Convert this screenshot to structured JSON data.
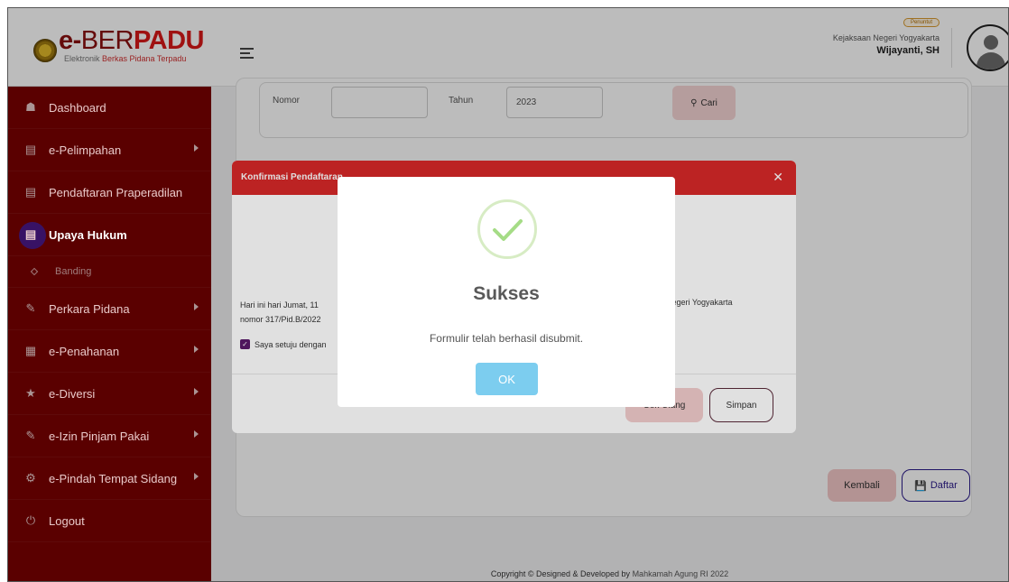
{
  "brand": {
    "name_e": "e-",
    "name_b1": "BER",
    "name_b2": "PADU",
    "sub_a": "Elektronik ",
    "sub_b": "Berkas Pidana Terpadu"
  },
  "sidebar": {
    "items": [
      {
        "label": "Dashboard",
        "icon": "home-icon"
      },
      {
        "label": "e-Pelimpahan",
        "icon": "document-icon",
        "arrow": true
      },
      {
        "label": "Pendaftaran Praperadilan",
        "icon": "document-icon"
      },
      {
        "label": "Upaya Hukum",
        "icon": "document-icon",
        "active": true
      },
      {
        "label": "Banding",
        "icon": "diamond-icon",
        "sub": true
      },
      {
        "label": "Perkara Pidana",
        "icon": "edit-icon",
        "arrow": true
      },
      {
        "label": "e-Penahanan",
        "icon": "grid-icon",
        "arrow": true
      },
      {
        "label": "e-Diversi",
        "icon": "star-icon",
        "arrow": true
      },
      {
        "label": "e-Izin Pinjam Pakai",
        "icon": "edit-icon",
        "arrow": true
      },
      {
        "label": "e-Pindah Tempat Sidang",
        "icon": "gear-icon",
        "arrow": true
      },
      {
        "label": "Logout",
        "icon": "power-icon"
      }
    ]
  },
  "header": {
    "role": "Penuntut",
    "org": "Kejaksaan Negeri Yogyakarta",
    "user": "Wijayanti, SH"
  },
  "search": {
    "nomor_label": "Nomor",
    "nomor_value": "",
    "tahun_label": "Tahun",
    "tahun_value": "2023",
    "button": "Cari"
  },
  "page_buttons": {
    "back": "Kembali",
    "submit": "Daftar"
  },
  "footer": {
    "prefix": "Copyright © Designed & Developed by ",
    "link": "Mahkamah Agung RI 2022"
  },
  "confirm_modal": {
    "title": "Konfirmasi Pendaftaran",
    "text_line1": "Hari ini hari Jumat, 11",
    "text_line1_end": "Negeri Yogyakarta",
    "text_line2": "nomor 317/Pid.B/2022",
    "checkbox_label": "Saya setuju dengan",
    "cancel": "Cek Ulang",
    "save": "Simpan"
  },
  "success_modal": {
    "title": "Sukses",
    "message": "Formulir telah berhasil disubmit.",
    "ok": "OK"
  },
  "colors": {
    "sidebar": "#7b0000",
    "accent_red": "#d62828",
    "ok_button": "#7ccdef",
    "success_ring": "#a5dc86"
  }
}
